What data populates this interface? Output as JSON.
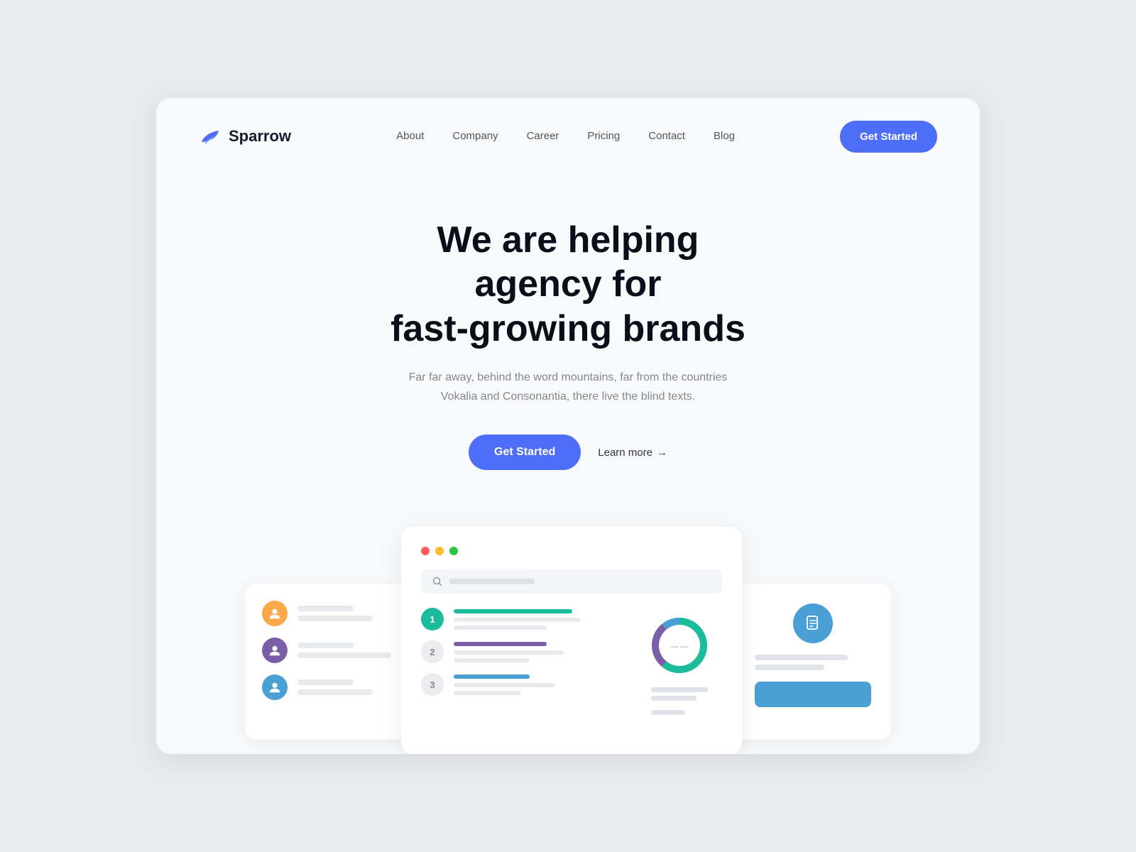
{
  "meta": {
    "bg_color": "#e8eaf0",
    "card_bg": "#f8f9fb"
  },
  "navbar": {
    "logo_text": "Sparrow",
    "nav_items": [
      {
        "label": "About",
        "href": "#"
      },
      {
        "label": "Company",
        "href": "#"
      },
      {
        "label": "Career",
        "href": "#"
      },
      {
        "label": "Pricing",
        "href": "#"
      },
      {
        "label": "Contact",
        "href": "#"
      },
      {
        "label": "Blog",
        "href": "#"
      }
    ],
    "cta_label": "Get Started",
    "accent_color": "#4f6ef7"
  },
  "hero": {
    "title_line1": "We are helping agency for",
    "title_line2": "fast-growing brands",
    "subtitle": "Far far away, behind the word mountains, far from the countries Vokalia and Consonantia, there live the blind texts.",
    "cta_primary": "Get Started",
    "cta_secondary": "Learn more",
    "cta_arrow": "→"
  },
  "illustration": {
    "window_dots": [
      "red",
      "yellow",
      "green"
    ],
    "rank_items": [
      {
        "rank": "1",
        "type": "active"
      },
      {
        "rank": "2",
        "type": "inactive"
      },
      {
        "rank": "3",
        "type": "inactive"
      }
    ],
    "avatars": [
      {
        "color": "orange"
      },
      {
        "color": "purple"
      },
      {
        "color": "blue"
      }
    ]
  }
}
